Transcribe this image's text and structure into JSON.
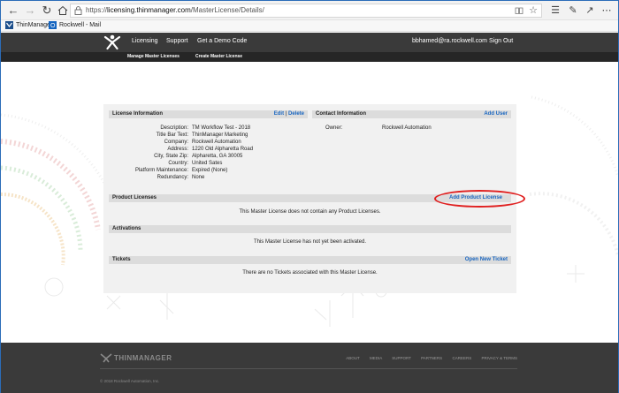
{
  "browser": {
    "url_prefix": "https://",
    "url_domain": "licensing.thinmanager.com",
    "url_path": "/MasterLicense/Details/"
  },
  "favorites": [
    {
      "label": "ThinManager",
      "icon": "thinmanager-favicon"
    },
    {
      "label": "Rockwell - Mail",
      "icon": "outlook-icon"
    }
  ],
  "site_nav": {
    "links": [
      "Licensing",
      "Support",
      "Get a Demo Code"
    ],
    "user": "bbhamed@ra.rockwell.com",
    "signout": "Sign Out",
    "sub_links": [
      "Manage Master Licenses",
      "Create Master License"
    ]
  },
  "license_info": {
    "title": "License Information",
    "edit": "Edit",
    "sep": "|",
    "delete": "Delete",
    "fields": [
      {
        "label": "Description:",
        "value": "TM Workflow Test - 2018"
      },
      {
        "label": "Title Bar Text:",
        "value": "ThinManager Marketing"
      },
      {
        "label": "Company:",
        "value": "Rockwell Automation"
      },
      {
        "label": "Address:",
        "value": "1220 Old Alpharetta Road"
      },
      {
        "label": "City, State Zip:",
        "value": "Alpharetta, GA 30005"
      },
      {
        "label": "Country:",
        "value": "United Sates"
      },
      {
        "label": "Platform Maintenance:",
        "value": "Expired (None)"
      },
      {
        "label": "Redundancy:",
        "value": "None"
      }
    ]
  },
  "contact_info": {
    "title": "Contact Information",
    "add_user": "Add User",
    "owner_label": "Owner:",
    "owner_value": "Rockwell Automation"
  },
  "product_licenses": {
    "title": "Product Licenses",
    "add": "Add Product License",
    "empty": "This Master License does not contain any Product Licenses."
  },
  "activations": {
    "title": "Activations",
    "empty": "This Master License has not yet been activated."
  },
  "tickets": {
    "title": "Tickets",
    "open": "Open New Ticket",
    "empty": "There are no Tickets associated with this Master License."
  },
  "footer": {
    "brand": "THINMANAGER",
    "links": [
      "ABOUT",
      "MEDIA",
      "SUPPORT",
      "PARTNERS",
      "CAREERS",
      "PRIVACY & TERMS"
    ],
    "copyright": "© 2018 Rockwell Automation, Inc."
  },
  "colors": {
    "accent_link": "#1a66c0",
    "header_bg": "#3a3a3a",
    "highlight_circle": "#e02020"
  }
}
